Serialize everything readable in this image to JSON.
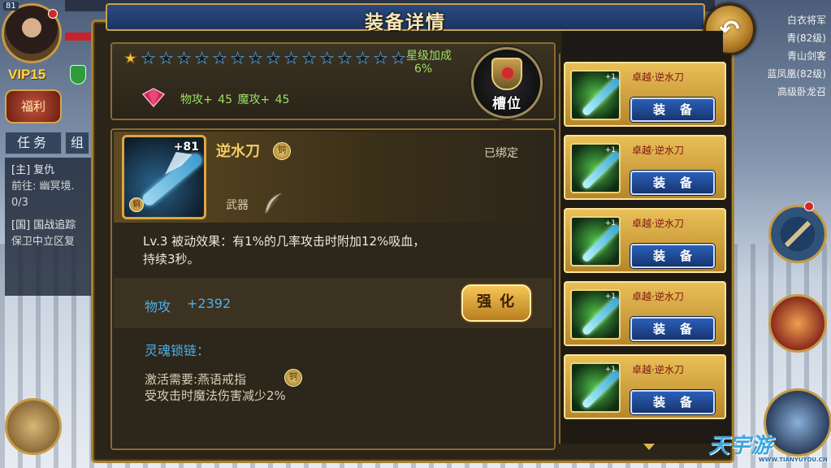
{
  "hud": {
    "player_level": "81",
    "vip": "VIP15",
    "welfare_label": "福利",
    "quest_tab": "任务",
    "team_tab": "组",
    "quests": [
      {
        "title": "[主] 复仇",
        "detail": "前往: 幽冥境.",
        "progress": "0/3"
      },
      {
        "title": "[国] 国战追踪",
        "detail": "保卫中立区复"
      }
    ],
    "right_info": [
      "白衣将军",
      "青(82级)",
      "青山剑客",
      "蓝凤凰(82级)",
      "高级卧龙召"
    ]
  },
  "dialog": {
    "title": "装备详情",
    "back_icon": "back-arrow-icon"
  },
  "star": {
    "total": 16,
    "lit": 1,
    "bonus_label": "星级加成",
    "bonus_value": "6%",
    "gem_stats": "物攻+ 45  魔攻+ 45",
    "slot_label": "槽位"
  },
  "item": {
    "name": "逆水刀",
    "enhance_level": "+81",
    "bound_status": "已绑定",
    "type_label": "武器",
    "coin_label": "铜",
    "passive": "Lv.3  被动效果：有1%的几率攻击时附加12%吸血，持续3秒。",
    "attack_label": "物攻",
    "attack_value": "+2392",
    "enhance_button": "强化",
    "soul_chain_label": "灵魂锁链：",
    "activate_requirement": "激活需要:燕语戒指",
    "damage_reduction": "受攻击时魔法伤害减少2%"
  },
  "list": {
    "items": [
      {
        "name": "卓越·逆水刀",
        "plus": "+1",
        "button": "装备"
      },
      {
        "name": "卓越·逆水刀",
        "plus": "+1",
        "button": "装备"
      },
      {
        "name": "卓越·逆水刀",
        "plus": "+1",
        "button": "装备"
      },
      {
        "name": "卓越·逆水刀",
        "plus": "+1",
        "button": "装备"
      },
      {
        "name": "卓越·逆水刀",
        "plus": "+1",
        "button": "装备"
      }
    ]
  },
  "watermark": {
    "text": "天宇游",
    "sub": "WWW.TIANYUYOU.CN"
  },
  "colors": {
    "accent_gold": "#c59a45",
    "stat_green": "#9be062",
    "stat_blue": "#4cb0e8",
    "item_name": "#f4cc63"
  }
}
